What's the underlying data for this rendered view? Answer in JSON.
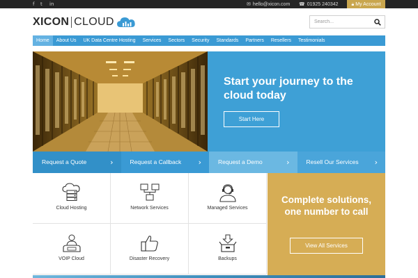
{
  "topbar": {
    "social": [
      {
        "icon": "facebook-icon",
        "glyph": "f"
      },
      {
        "icon": "twitter-icon",
        "glyph": "t"
      },
      {
        "icon": "linkedin-icon",
        "glyph": "in"
      }
    ],
    "email": "hello@xicon.com",
    "email_icon": "envelope-icon",
    "phone": "01925 240342",
    "phone_icon": "phone-icon",
    "account": "My Account",
    "account_icon": "lock-icon"
  },
  "brand": {
    "name_left": "XICON",
    "name_right": "CLOUD"
  },
  "search": {
    "placeholder": "Search..."
  },
  "nav": [
    {
      "label": "Home",
      "active": true
    },
    {
      "label": "About Us"
    },
    {
      "label": "UK Data Centre Hosting"
    },
    {
      "label": "Services"
    },
    {
      "label": "Sectors"
    },
    {
      "label": "Security"
    },
    {
      "label": "Standards"
    },
    {
      "label": "Partners"
    },
    {
      "label": "Resellers"
    },
    {
      "label": "Testimonials"
    }
  ],
  "hero": {
    "title": "Start your journey to the cloud today",
    "button": "Start Here"
  },
  "quick_links": [
    {
      "label": "Request a Quote",
      "color": "#3290c8"
    },
    {
      "label": "Request a Callback",
      "color": "#3a9ad4"
    },
    {
      "label": "Request a Demo",
      "color": "#6bb8e2"
    },
    {
      "label": "Resell Our Services",
      "color": "#4aa5da"
    }
  ],
  "services": [
    {
      "label": "Cloud Hosting",
      "icon": "cloud-server-icon"
    },
    {
      "label": "Network Services",
      "icon": "network-icon"
    },
    {
      "label": "Managed Services",
      "icon": "support-agent-icon"
    },
    {
      "label": "VOIP Cloud",
      "icon": "voip-phone-icon"
    },
    {
      "label": "Disaster Recovery",
      "icon": "thumbs-up-icon"
    },
    {
      "label": "Backups",
      "icon": "backup-box-icon"
    }
  ],
  "promo": {
    "title": "Complete solutions, one number to call",
    "button": "View All Services"
  },
  "colors": {
    "brand_blue": "#3a9ad4",
    "gold": "#d6ad55",
    "topbar": "#252525"
  }
}
